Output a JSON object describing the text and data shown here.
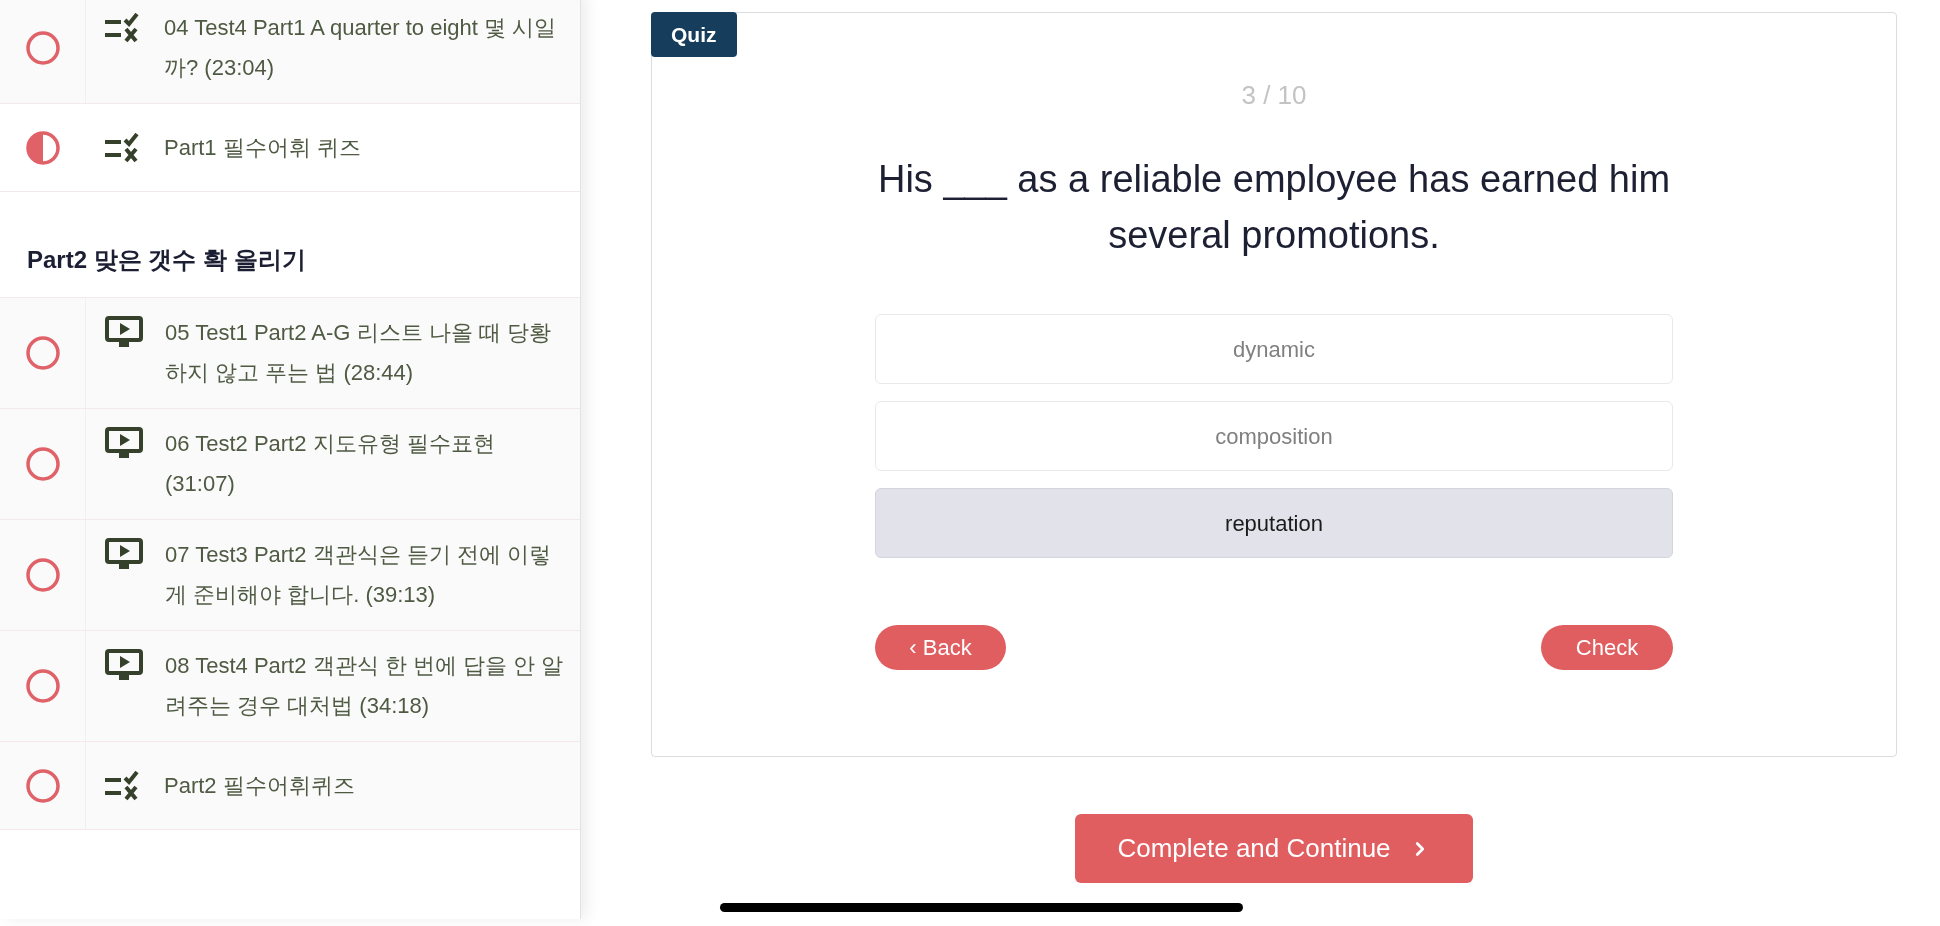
{
  "sidebar": {
    "sections": [
      {
        "items": [
          {
            "kind": "quiz",
            "title": "04 Test4 Part1 A quarter to eight 몇 시일까? (23:04)",
            "started": false,
            "selected": false
          },
          {
            "kind": "quiz",
            "title": "Part1 필수어휘 퀴즈",
            "started": true,
            "selected": true
          }
        ]
      },
      {
        "title": "Part2 맞은 갯수 확 올리기",
        "items": [
          {
            "kind": "video",
            "title": "05 Test1 Part2 A-G 리스트 나올 때 당황하지 않고 푸는 법 (28:44)",
            "started": false,
            "selected": false
          },
          {
            "kind": "video",
            "title": "06 Test2 Part2 지도유형 필수표현 (31:07)",
            "started": false,
            "selected": false
          },
          {
            "kind": "video",
            "title": "07 Test3 Part2 객관식은 듣기 전에 이렇게 준비해야 합니다. (39:13)",
            "started": false,
            "selected": false
          },
          {
            "kind": "video",
            "title": "08 Test4 Part2 객관식 한 번에 답을 안 알려주는 경우 대처법 (34:18)",
            "started": false,
            "selected": false
          },
          {
            "kind": "quiz",
            "title": "Part2 필수어휘퀴즈",
            "started": false,
            "selected": false
          }
        ]
      }
    ]
  },
  "quiz": {
    "badge": "Quiz",
    "progress": "3 / 10",
    "question": "His ___ as a reliable employee has earned him several promotions.",
    "options": [
      {
        "label": "dynamic",
        "selected": false
      },
      {
        "label": "composition",
        "selected": false
      },
      {
        "label": "reputation",
        "selected": true
      }
    ],
    "back_button": "‹ Back",
    "check_button": "Check"
  },
  "complete_button": "Complete and Continue"
}
